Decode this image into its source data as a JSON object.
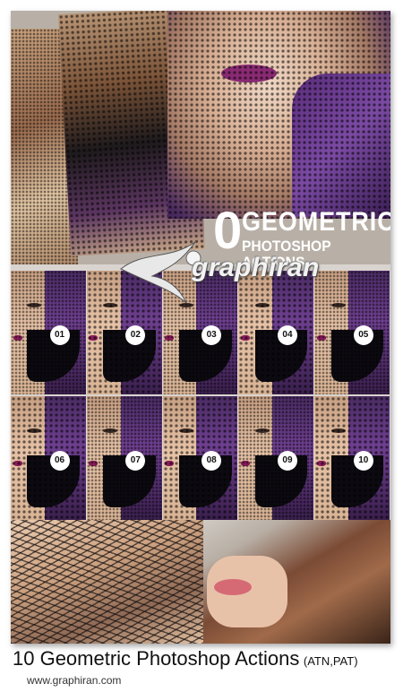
{
  "poster": {
    "counter_digit": "0",
    "title_line1": "GEOMETRIC",
    "title_line2": "PHOTOSHOP ACTIONS"
  },
  "logo": {
    "text": "graphiran"
  },
  "variations": [
    {
      "label": "01"
    },
    {
      "label": "02"
    },
    {
      "label": "03"
    },
    {
      "label": "04"
    },
    {
      "label": "05"
    },
    {
      "label": "06"
    },
    {
      "label": "07"
    },
    {
      "label": "08"
    },
    {
      "label": "09"
    },
    {
      "label": "10"
    }
  ],
  "caption": {
    "title": "10 Geometric Photoshop Actions",
    "formats": "(ATN,PAT)",
    "website": "www.graphiran.com"
  },
  "colors": {
    "accent_purple": "#6e3f8f",
    "banner_dark": "#1c1c1c",
    "skin": "#d9b091"
  }
}
